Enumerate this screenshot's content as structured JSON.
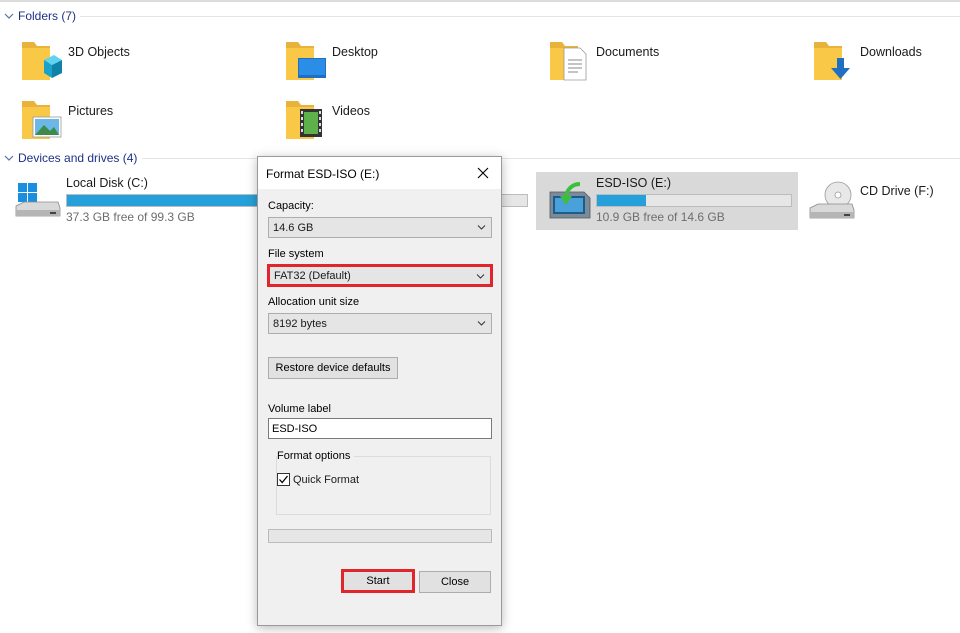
{
  "folders_group": {
    "label": "Folders (7)"
  },
  "folders": [
    {
      "name": "3D Objects",
      "icon": "3d-objects-folder-icon"
    },
    {
      "name": "Desktop",
      "icon": "desktop-folder-icon"
    },
    {
      "name": "Documents",
      "icon": "documents-folder-icon"
    },
    {
      "name": "Downloads",
      "icon": "downloads-folder-icon"
    },
    {
      "name": "Pictures",
      "icon": "pictures-folder-icon"
    },
    {
      "name": "Videos",
      "icon": "videos-folder-icon"
    }
  ],
  "drives_group": {
    "label": "Devices and drives (4)"
  },
  "drives": [
    {
      "name": "Local Disk (C:)",
      "free": "37.3 GB free of 99.3 GB",
      "used_fraction": 0.62
    },
    {
      "name": "ESD-ISO (E:)",
      "free": "10.9 GB free of 14.6 GB",
      "used_fraction": 0.25
    },
    {
      "name": "CD Drive (F:)"
    }
  ],
  "dialog": {
    "title": "Format ESD-ISO (E:)",
    "capacity_label": "Capacity:",
    "capacity_value": "14.6 GB",
    "filesystem_label": "File system",
    "filesystem_value": "FAT32 (Default)",
    "allocation_label": "Allocation unit size",
    "allocation_value": "8192 bytes",
    "restore_button": "Restore device defaults",
    "volume_label": "Volume label",
    "volume_value": "ESD-ISO",
    "format_options_label": "Format options",
    "quick_format_label": "Quick Format",
    "quick_format_checked": true,
    "progress_fraction": 0,
    "start_button": "Start",
    "close_button": "Close"
  },
  "colors": {
    "accent": "#26a0da",
    "highlight": "#e1262b",
    "group_header": "#1e3287",
    "folder_yellow": "#f8c846"
  }
}
